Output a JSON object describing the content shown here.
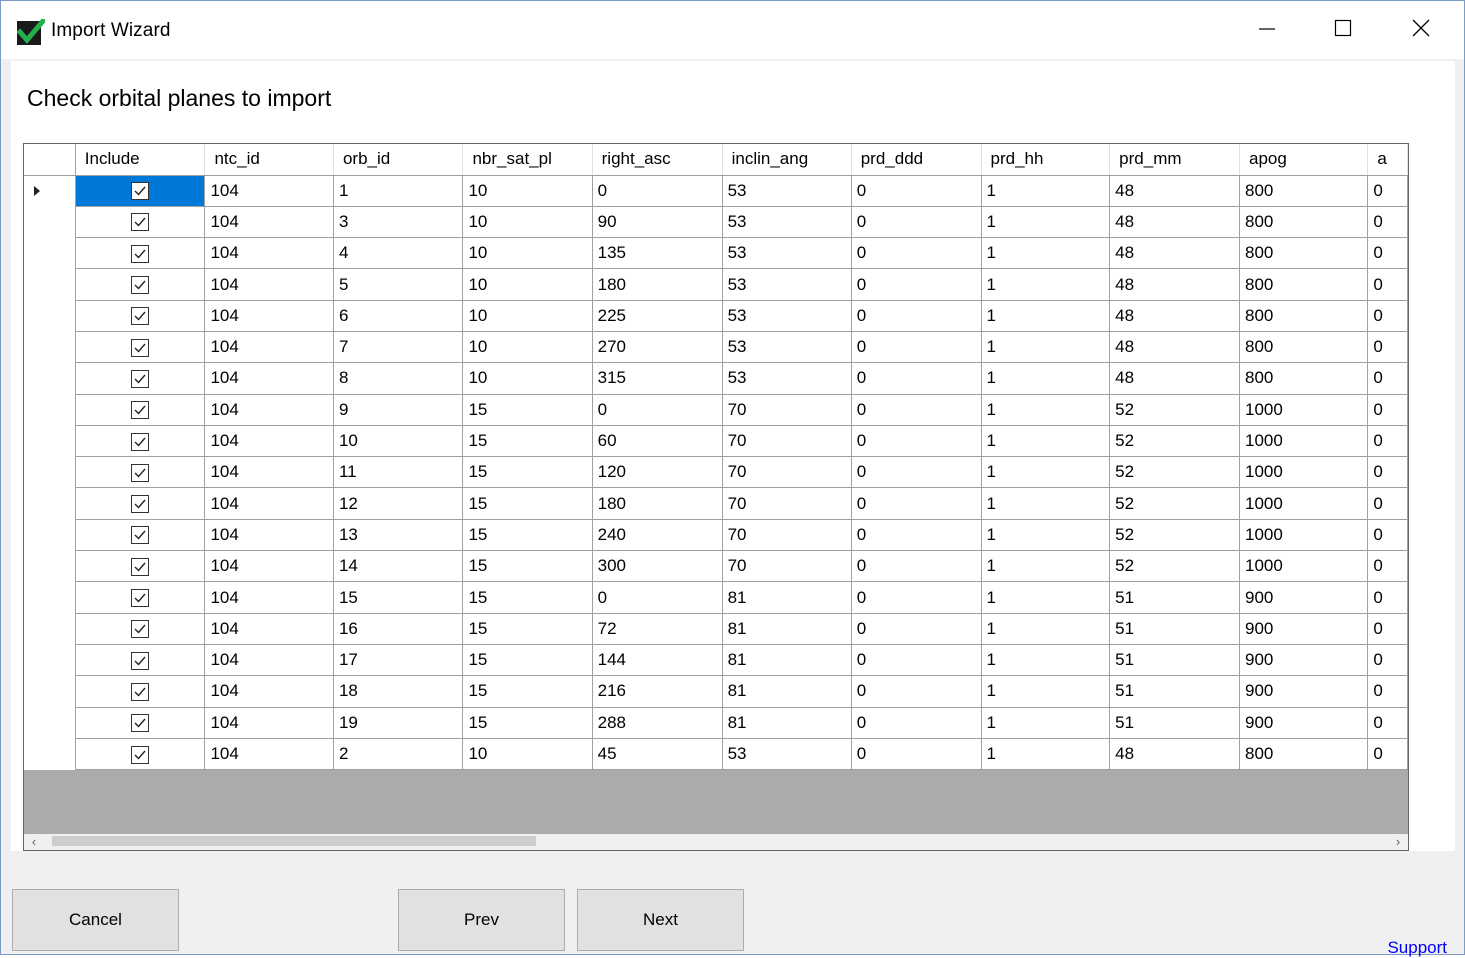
{
  "window": {
    "title": "Import Wizard",
    "controls": {
      "minimize": "minimize-icon",
      "maximize": "maximize-icon",
      "close": "close-icon"
    }
  },
  "heading": "Check orbital planes to import",
  "grid": {
    "columns": [
      "Include",
      "ntc_id",
      "orb_id",
      "nbr_sat_pl",
      "right_asc",
      "inclin_ang",
      "prd_ddd",
      "prd_hh",
      "prd_mm",
      "apog",
      "a"
    ],
    "selected_row": 0,
    "rows": [
      {
        "include": true,
        "cells": [
          "104",
          "1",
          "10",
          "0",
          "53",
          "0",
          "1",
          "48",
          "800",
          "0"
        ]
      },
      {
        "include": true,
        "cells": [
          "104",
          "3",
          "10",
          "90",
          "53",
          "0",
          "1",
          "48",
          "800",
          "0"
        ]
      },
      {
        "include": true,
        "cells": [
          "104",
          "4",
          "10",
          "135",
          "53",
          "0",
          "1",
          "48",
          "800",
          "0"
        ]
      },
      {
        "include": true,
        "cells": [
          "104",
          "5",
          "10",
          "180",
          "53",
          "0",
          "1",
          "48",
          "800",
          "0"
        ]
      },
      {
        "include": true,
        "cells": [
          "104",
          "6",
          "10",
          "225",
          "53",
          "0",
          "1",
          "48",
          "800",
          "0"
        ]
      },
      {
        "include": true,
        "cells": [
          "104",
          "7",
          "10",
          "270",
          "53",
          "0",
          "1",
          "48",
          "800",
          "0"
        ]
      },
      {
        "include": true,
        "cells": [
          "104",
          "8",
          "10",
          "315",
          "53",
          "0",
          "1",
          "48",
          "800",
          "0"
        ]
      },
      {
        "include": true,
        "cells": [
          "104",
          "9",
          "15",
          "0",
          "70",
          "0",
          "1",
          "52",
          "1000",
          "0"
        ]
      },
      {
        "include": true,
        "cells": [
          "104",
          "10",
          "15",
          "60",
          "70",
          "0",
          "1",
          "52",
          "1000",
          "0"
        ]
      },
      {
        "include": true,
        "cells": [
          "104",
          "11",
          "15",
          "120",
          "70",
          "0",
          "1",
          "52",
          "1000",
          "0"
        ]
      },
      {
        "include": true,
        "cells": [
          "104",
          "12",
          "15",
          "180",
          "70",
          "0",
          "1",
          "52",
          "1000",
          "0"
        ]
      },
      {
        "include": true,
        "cells": [
          "104",
          "13",
          "15",
          "240",
          "70",
          "0",
          "1",
          "52",
          "1000",
          "0"
        ]
      },
      {
        "include": true,
        "cells": [
          "104",
          "14",
          "15",
          "300",
          "70",
          "0",
          "1",
          "52",
          "1000",
          "0"
        ]
      },
      {
        "include": true,
        "cells": [
          "104",
          "15",
          "15",
          "0",
          "81",
          "0",
          "1",
          "51",
          "900",
          "0"
        ]
      },
      {
        "include": true,
        "cells": [
          "104",
          "16",
          "15",
          "72",
          "81",
          "0",
          "1",
          "51",
          "900",
          "0"
        ]
      },
      {
        "include": true,
        "cells": [
          "104",
          "17",
          "15",
          "144",
          "81",
          "0",
          "1",
          "51",
          "900",
          "0"
        ]
      },
      {
        "include": true,
        "cells": [
          "104",
          "18",
          "15",
          "216",
          "81",
          "0",
          "1",
          "51",
          "900",
          "0"
        ]
      },
      {
        "include": true,
        "cells": [
          "104",
          "19",
          "15",
          "288",
          "81",
          "0",
          "1",
          "51",
          "900",
          "0"
        ]
      },
      {
        "include": true,
        "cells": [
          "104",
          "2",
          "10",
          "45",
          "53",
          "0",
          "1",
          "48",
          "800",
          "0"
        ]
      }
    ]
  },
  "buttons": {
    "cancel": "Cancel",
    "prev": "Prev",
    "next": "Next"
  },
  "support_link": "Support",
  "colors": {
    "selection": "#0078d7",
    "link": "#0000ff",
    "grid_background": "#ababab"
  }
}
